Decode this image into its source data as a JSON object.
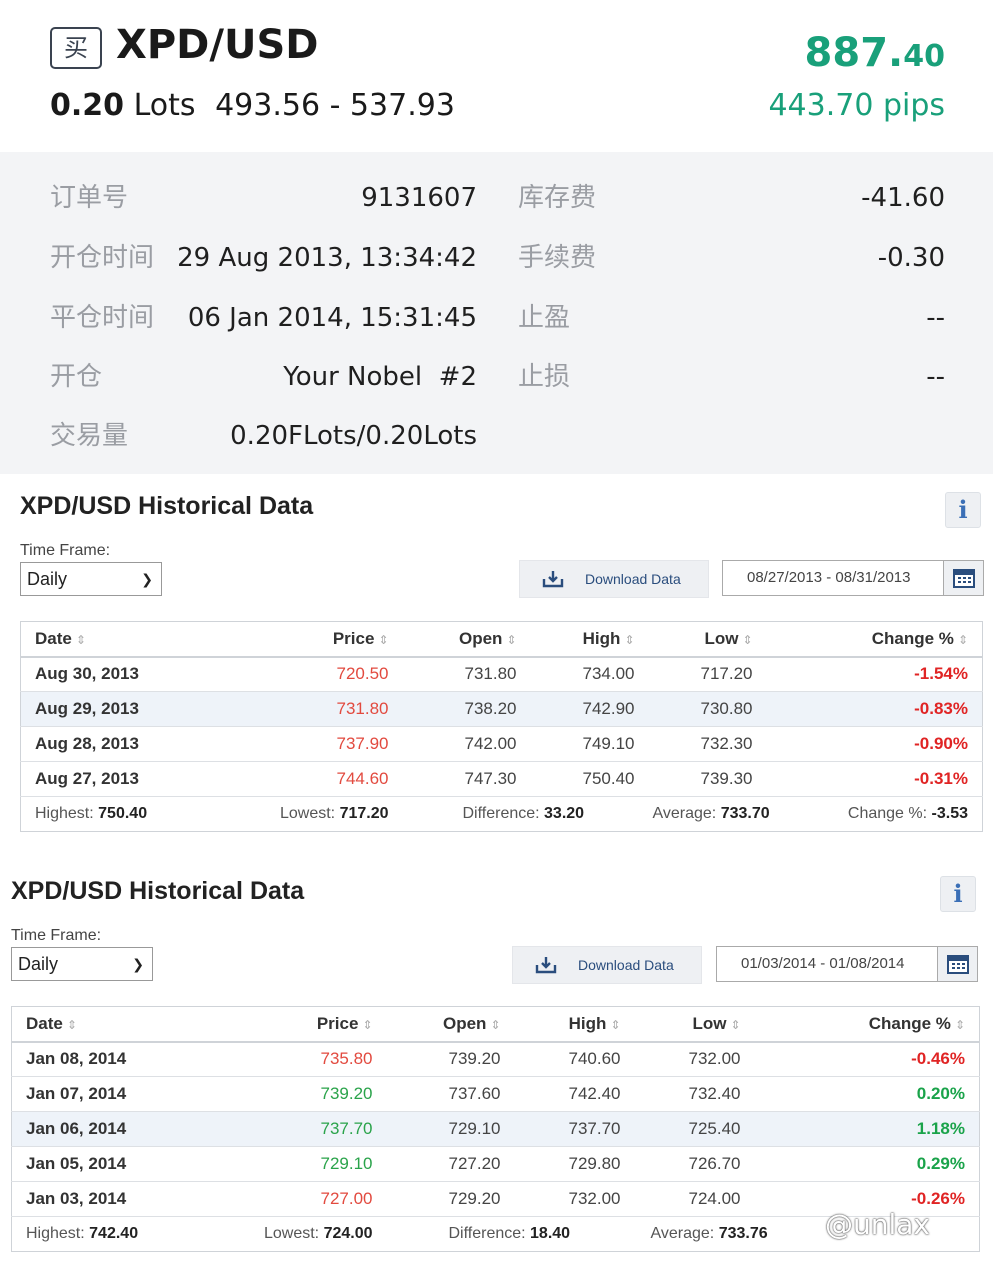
{
  "trade": {
    "direction_badge": "买",
    "symbol": "XPD/USD",
    "lots": "0.20",
    "lots_unit": "Lots",
    "price_range": "493.56 - 537.93",
    "current_price_main": "887.",
    "current_price_decimals": "40",
    "pips": "443.70 pips"
  },
  "details": {
    "order_no_label": "订单号",
    "order_no": "9131607",
    "open_time_label": "开仓时间",
    "open_time": "29 Aug 2013, 13:34:42",
    "close_time_label": "平仓时间",
    "close_time": "06 Jan 2014, 15:31:45",
    "open_label": "开仓",
    "open_value": "Your Nobel  #2",
    "volume_label": "交易量",
    "volume": "0.20FLots/0.20Lots",
    "swap_label": "库存费",
    "swap": "-41.60",
    "commission_label": "手续费",
    "commission": "-0.30",
    "take_profit_label": "止盈",
    "take_profit": "--",
    "stop_loss_label": "止损",
    "stop_loss": "--"
  },
  "hist1": {
    "title": "XPD/USD Historical Data",
    "info_icon": "i",
    "timeframe_label": "Time Frame:",
    "timeframe_value": "Daily",
    "download_label": "Download Data",
    "date_range": "08/27/2013 - 08/31/2013",
    "columns": [
      "Date",
      "Price",
      "Open",
      "High",
      "Low",
      "Change %"
    ],
    "rows": [
      {
        "date": "Aug 30, 2013",
        "price": "720.50",
        "open": "731.80",
        "high": "734.00",
        "low": "717.20",
        "change": "-1.54%"
      },
      {
        "date": "Aug 29, 2013",
        "price": "731.80",
        "open": "738.20",
        "high": "742.90",
        "low": "730.80",
        "change": "-0.83%"
      },
      {
        "date": "Aug 28, 2013",
        "price": "737.90",
        "open": "742.00",
        "high": "749.10",
        "low": "732.30",
        "change": "-0.90%"
      },
      {
        "date": "Aug 27, 2013",
        "price": "744.60",
        "open": "747.30",
        "high": "750.40",
        "low": "739.30",
        "change": "-0.31%"
      }
    ],
    "summary": {
      "highest_label": "Highest:",
      "highest": "750.40",
      "lowest_label": "Lowest:",
      "lowest": "717.20",
      "difference_label": "Difference:",
      "difference": "33.20",
      "average_label": "Average:",
      "average": "733.70",
      "change_label": "Change %:",
      "change": "-3.53"
    }
  },
  "hist2": {
    "title": "XPD/USD Historical Data",
    "info_icon": "i",
    "timeframe_label": "Time Frame:",
    "timeframe_value": "Daily",
    "download_label": "Download Data",
    "date_range": "01/03/2014 - 01/08/2014",
    "columns": [
      "Date",
      "Price",
      "Open",
      "High",
      "Low",
      "Change %"
    ],
    "rows": [
      {
        "date": "Jan 08, 2014",
        "price": "735.80",
        "open": "739.20",
        "high": "740.60",
        "low": "732.00",
        "change": "-0.46%"
      },
      {
        "date": "Jan 07, 2014",
        "price": "739.20",
        "open": "737.60",
        "high": "742.40",
        "low": "732.40",
        "change": "0.20%"
      },
      {
        "date": "Jan 06, 2014",
        "price": "737.70",
        "open": "729.10",
        "high": "737.70",
        "low": "725.40",
        "change": "1.18%"
      },
      {
        "date": "Jan 05, 2014",
        "price": "729.10",
        "open": "727.20",
        "high": "729.80",
        "low": "726.70",
        "change": "0.29%"
      },
      {
        "date": "Jan 03, 2014",
        "price": "727.00",
        "open": "729.20",
        "high": "732.00",
        "low": "724.00",
        "change": "-0.26%"
      }
    ],
    "summary": {
      "highest_label": "Highest:",
      "highest": "742.40",
      "lowest_label": "Lowest:",
      "lowest": "724.00",
      "difference_label": "Difference:",
      "difference": "18.40",
      "average_label": "Average:",
      "average": "733.76"
    }
  },
  "watermark": "@unlax",
  "colors": {
    "profit_green": "#19a07a",
    "loss_red": "#e02424",
    "gain_green": "#1aa34a",
    "detail_bg": "#f3f4f6",
    "highlight_row": "#eef3f9"
  }
}
